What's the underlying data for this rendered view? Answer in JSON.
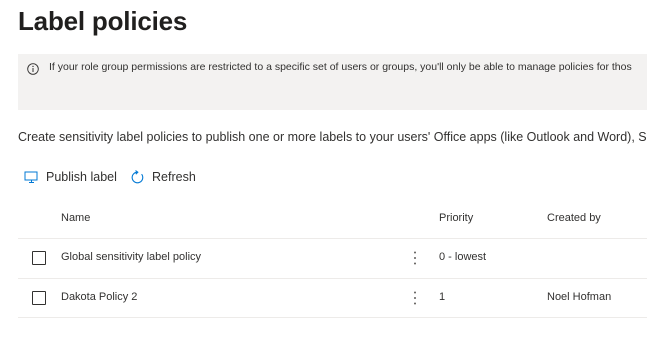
{
  "page": {
    "title": "Label policies"
  },
  "info": {
    "icon": "info-icon",
    "text": "If your role group permissions are restricted to a specific set of users or groups, you'll only be able to manage policies for thos"
  },
  "description": "Create sensitivity label policies to publish one or more labels to your users' Office apps (like Outlook and Word), S",
  "toolbar": {
    "publish_label": "Publish label",
    "publish_icon": "publish-icon",
    "refresh_label": "Refresh",
    "refresh_icon": "refresh-icon"
  },
  "table": {
    "columns": [
      "Name",
      "Priority",
      "Created by"
    ],
    "rows": [
      {
        "name": "Global sensitivity label policy",
        "priority": "0 - lowest",
        "created_by": ""
      },
      {
        "name": "Dakota Policy 2",
        "priority": "1",
        "created_by": "Noel Hofman"
      }
    ]
  },
  "colors": {
    "info_bar_bg": "#f3f2f1",
    "text": "#323130",
    "title": "#201f1e",
    "divider": "#edebe9"
  }
}
